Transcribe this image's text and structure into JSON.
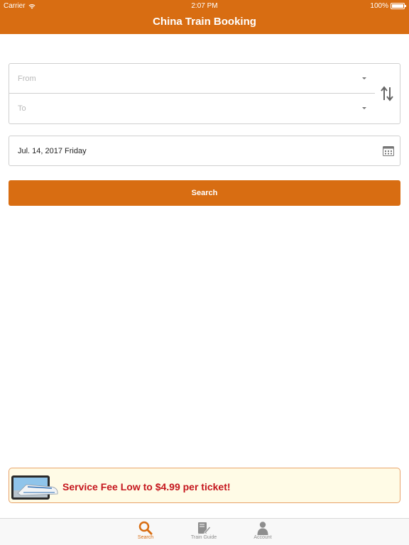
{
  "status_bar": {
    "carrier": "Carrier",
    "time": "2:07 PM",
    "battery": "100%"
  },
  "nav": {
    "title": "China Train Booking"
  },
  "form": {
    "from_placeholder": "From",
    "to_placeholder": "To",
    "date": "Jul. 14, 2017 Friday",
    "search_label": "Search"
  },
  "promo": {
    "text": "Service Fee Low to $4.99 per ticket!"
  },
  "tabs": [
    {
      "label": "Search",
      "icon": "search-icon",
      "active": true
    },
    {
      "label": "Train Guide",
      "icon": "guide-book-icon",
      "active": false
    },
    {
      "label": "Account",
      "icon": "person-icon",
      "active": false
    }
  ],
  "colors": {
    "accent": "#d86d12",
    "promo_text": "#c5161d",
    "promo_bg": "#fffbe6"
  }
}
